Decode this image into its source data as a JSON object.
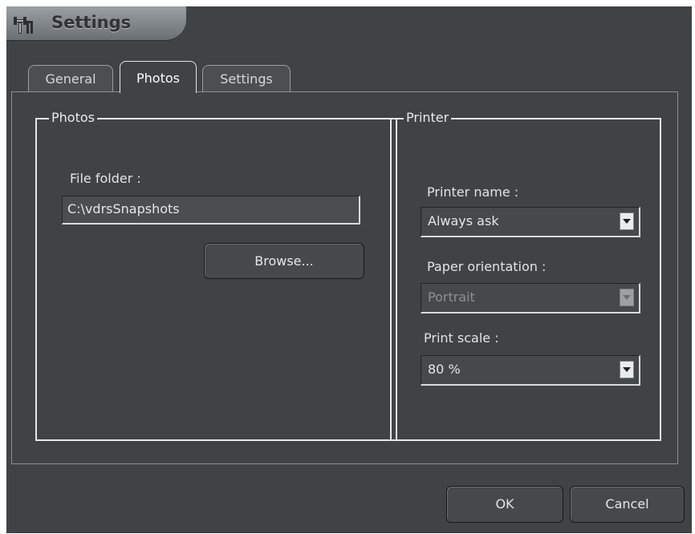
{
  "window": {
    "title": "Settings"
  },
  "tabs": [
    {
      "label": "General",
      "active": false
    },
    {
      "label": "Photos",
      "active": true
    },
    {
      "label": "Settings",
      "active": false
    }
  ],
  "photos_group": {
    "legend": "Photos",
    "file_folder_label": "File folder :",
    "file_folder_value": "C:\\vdrsSnapshots",
    "browse_label": "Browse..."
  },
  "printer_group": {
    "legend": "Printer",
    "printer_name_label": "Printer name :",
    "printer_name_value": "Always ask",
    "paper_orientation_label": "Paper orientation :",
    "paper_orientation_value": "Portrait",
    "paper_orientation_disabled": true,
    "print_scale_label": "Print scale :",
    "print_scale_value": "80 %"
  },
  "footer": {
    "ok_label": "OK",
    "cancel_label": "Cancel"
  },
  "icons": {
    "title": "settings-icon",
    "dropdown": "chevron-down-icon"
  }
}
